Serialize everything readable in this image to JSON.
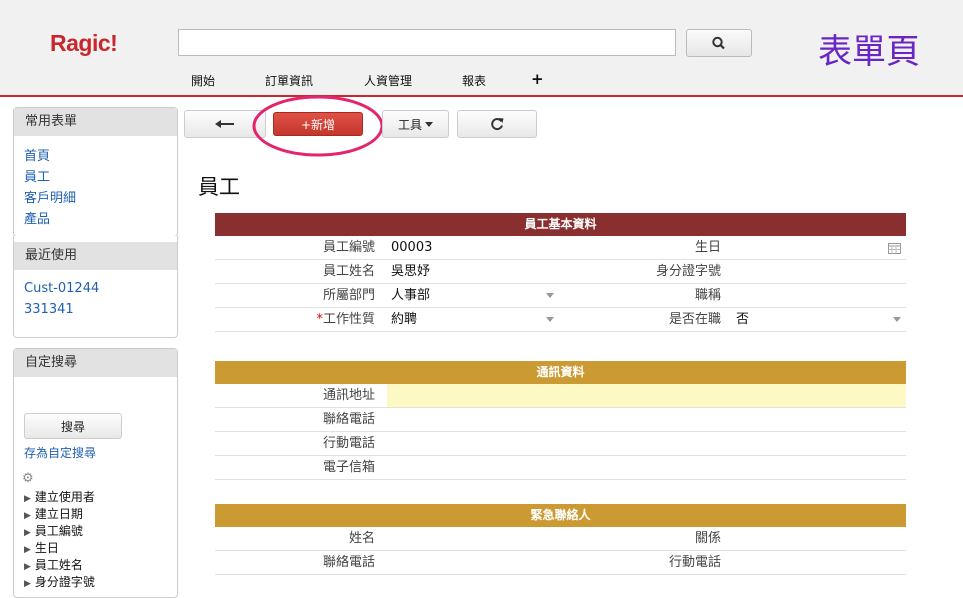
{
  "header": {
    "logo": "Ragic!",
    "search_value": "",
    "page_label": "表單頁",
    "nav": [
      "開始",
      "訂單資訊",
      "人資管理",
      "報表",
      "+"
    ]
  },
  "sidebar": {
    "common_forms": {
      "title": "常用表單",
      "items": [
        "首頁",
        "員工",
        "客戶明細",
        "產品"
      ]
    },
    "recent": {
      "title": "最近使用",
      "items": [
        "Cust-01244",
        "331341"
      ]
    },
    "custom_search": {
      "title": "自定搜尋",
      "search_button": "搜尋",
      "save_link": "存為自定搜尋",
      "fields": [
        "建立使用者",
        "建立日期",
        "員工編號",
        "生日",
        "員工姓名",
        "身分證字號"
      ]
    }
  },
  "toolbar": {
    "new_label": "+新增",
    "tools_label": "工具"
  },
  "form": {
    "title": "員工",
    "colors": {
      "basic": "#8a2f2f",
      "contact": "#cc9a33",
      "highlight": "#fdf9c4"
    },
    "basic": {
      "header": "員工基本資料",
      "rows": [
        {
          "l1": "員工編號",
          "v1": "00003",
          "l2": "生日",
          "v2": ""
        },
        {
          "l1": "員工姓名",
          "v1": "吳思妤",
          "l2": "身分證字號",
          "v2": ""
        },
        {
          "l1": "所屬部門",
          "v1": "人事部",
          "l2": "職稱",
          "v2": ""
        },
        {
          "req": "*",
          "l1": "工作性質",
          "v1": "約聘",
          "l2": "是否在職",
          "v2": "否"
        }
      ]
    },
    "contact": {
      "header": "通訊資料",
      "rows": [
        "通訊地址",
        "聯絡電話",
        "行動電話",
        "電子信箱"
      ]
    },
    "emergency": {
      "header": "緊急聯絡人",
      "rows": [
        {
          "l1": "姓名",
          "l2": "關係"
        },
        {
          "l1": "聯絡電話",
          "l2": "行動電話"
        }
      ]
    }
  }
}
